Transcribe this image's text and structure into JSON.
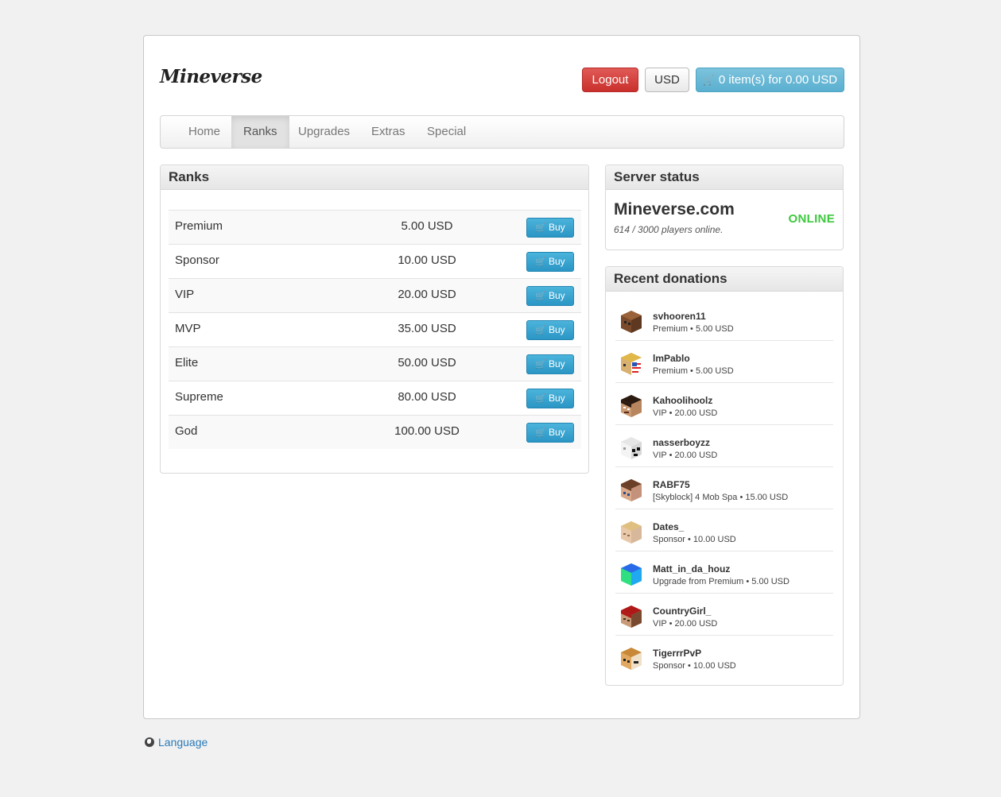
{
  "header": {
    "logo": "Mineverse",
    "logout_label": "Logout",
    "currency_label": "USD",
    "cart_label": "0 item(s) for 0.00 USD"
  },
  "nav": {
    "items": [
      "Home",
      "Ranks",
      "Upgrades",
      "Extras",
      "Special"
    ],
    "active": "Ranks"
  },
  "ranks": {
    "title": "Ranks",
    "buy_label": "Buy",
    "rows": [
      {
        "name": "Premium",
        "price": "5.00 USD"
      },
      {
        "name": "Sponsor",
        "price": "10.00 USD"
      },
      {
        "name": "VIP",
        "price": "20.00 USD"
      },
      {
        "name": "MVP",
        "price": "35.00 USD"
      },
      {
        "name": "Elite",
        "price": "50.00 USD"
      },
      {
        "name": "Supreme",
        "price": "80.00 USD"
      },
      {
        "name": "God",
        "price": "100.00 USD"
      }
    ]
  },
  "server_status": {
    "title": "Server status",
    "server": "Mineverse.com",
    "players": "614 / 3000 players online.",
    "status": "ONLINE"
  },
  "donations": {
    "title": "Recent donations",
    "items": [
      {
        "name": "svhooren11",
        "info": "Premium • 5.00 USD",
        "avatar": "brown-bear-head"
      },
      {
        "name": "lmPablo",
        "info": "Premium • 5.00 USD",
        "avatar": "flag-head"
      },
      {
        "name": "Kahoolihoolz",
        "info": "VIP • 20.00 USD",
        "avatar": "dark-hair-head"
      },
      {
        "name": "nasserboyzz",
        "info": "VIP • 20.00 USD",
        "avatar": "white-panda-head"
      },
      {
        "name": "RABF75",
        "info": "[Skyblock] 4 Mob Spa • 15.00 USD",
        "avatar": "brown-hair-head"
      },
      {
        "name": "Dates_",
        "info": "Sponsor • 10.00 USD",
        "avatar": "blond-head"
      },
      {
        "name": "Matt_in_da_houz",
        "info": "Upgrade from Premium • 5.00 USD",
        "avatar": "rainbow-head"
      },
      {
        "name": "CountryGirl_",
        "info": "VIP • 20.00 USD",
        "avatar": "red-hat-head"
      },
      {
        "name": "TigerrrPvP",
        "info": "Sponsor • 10.00 USD",
        "avatar": "tiger-head"
      }
    ]
  },
  "footer": {
    "language_label": "Language"
  },
  "colors": {
    "logout": "#c9302c",
    "cart": "#5aafcf",
    "buy": "#2b95c5",
    "online": "#3cc93c",
    "link": "#2a7ab8"
  }
}
